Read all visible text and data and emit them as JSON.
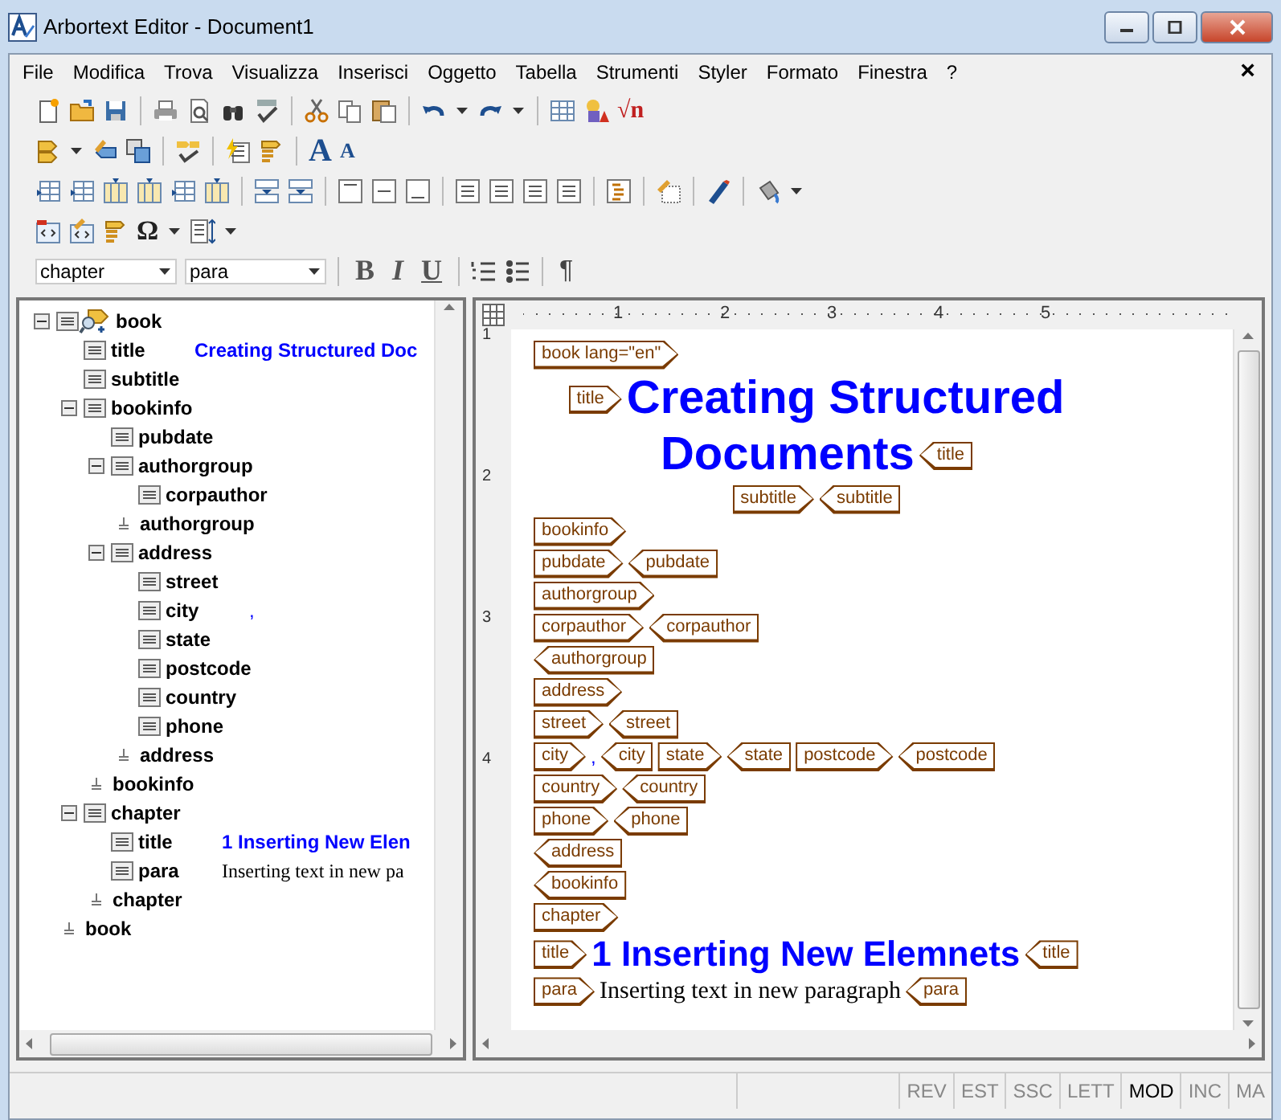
{
  "window": {
    "title": "Arbortext Editor - Document1"
  },
  "menu": {
    "items": [
      "File",
      "Modifica",
      "Trova",
      "Visualizza",
      "Inserisci",
      "Oggetto",
      "Tabella",
      "Strumenti",
      "Styler",
      "Formato",
      "Finestra",
      "?"
    ],
    "close": "×"
  },
  "toolbar_glyphs": [
    "√n",
    "A",
    "A",
    "Ω"
  ],
  "format_bar": {
    "element": "chapter",
    "style": "para",
    "buttons": [
      "B",
      "I",
      "U"
    ],
    "pilcrow": "¶"
  },
  "tree": [
    {
      "tag": "book",
      "kind": "open",
      "expanded": true,
      "children": [
        {
          "tag": "title",
          "kind": "leaf",
          "value": {
            "kind": "heading",
            "text": "Creating Structured Doc"
          }
        },
        {
          "tag": "subtitle",
          "kind": "leaf"
        },
        {
          "tag": "bookinfo",
          "kind": "open",
          "expanded": true,
          "children": [
            {
              "tag": "pubdate",
              "kind": "leaf"
            },
            {
              "tag": "authorgroup",
              "kind": "open",
              "expanded": true,
              "children": [
                {
                  "tag": "corpauthor",
                  "kind": "leaf"
                }
              ]
            },
            {
              "tag": "authorgroup",
              "kind": "close"
            },
            {
              "tag": "address",
              "kind": "open",
              "expanded": true,
              "children": [
                {
                  "tag": "street",
                  "kind": "leaf"
                },
                {
                  "tag": "city",
                  "kind": "leaf",
                  "value": {
                    "kind": "value",
                    "text": ","
                  }
                },
                {
                  "tag": "state",
                  "kind": "leaf"
                },
                {
                  "tag": "postcode",
                  "kind": "leaf"
                },
                {
                  "tag": "country",
                  "kind": "leaf"
                },
                {
                  "tag": "phone",
                  "kind": "leaf"
                }
              ]
            },
            {
              "tag": "address",
              "kind": "close"
            }
          ]
        },
        {
          "tag": "bookinfo",
          "kind": "close"
        },
        {
          "tag": "chapter",
          "kind": "open",
          "expanded": true,
          "children": [
            {
              "tag": "title",
              "kind": "leaf",
              "value": {
                "kind": "heading",
                "text": "1 Inserting New Elen"
              }
            },
            {
              "tag": "para",
              "kind": "leaf",
              "value": {
                "kind": "text",
                "text": "Inserting text in new pa"
              }
            }
          ]
        },
        {
          "tag": "chapter",
          "kind": "close"
        }
      ]
    },
    {
      "tag": "book",
      "kind": "close"
    }
  ],
  "ruler": {
    "marks": [
      "1",
      "2",
      "3",
      "4",
      "5"
    ]
  },
  "vertical_ruler": {
    "marks": [
      "1",
      "2",
      "3",
      "4"
    ]
  },
  "document": {
    "lines": [
      {
        "centered": false,
        "items": [
          {
            "kind": "open",
            "tag": "book lang=\"en\""
          }
        ]
      },
      {
        "centered": true,
        "items": [
          {
            "kind": "open",
            "tag": "title"
          },
          {
            "kind": "title",
            "text": "Creating Structured"
          }
        ]
      },
      {
        "centered": true,
        "items": [
          {
            "kind": "title",
            "text": "Documents"
          },
          {
            "kind": "close",
            "tag": "title"
          }
        ]
      },
      {
        "centered": true,
        "items": [
          {
            "kind": "open",
            "tag": "subtitle"
          },
          {
            "kind": "close",
            "tag": "subtitle"
          }
        ]
      },
      {
        "centered": false,
        "items": [
          {
            "kind": "open",
            "tag": "bookinfo"
          }
        ]
      },
      {
        "centered": false,
        "items": [
          {
            "kind": "open",
            "tag": "pubdate"
          },
          {
            "kind": "close",
            "tag": "pubdate"
          }
        ]
      },
      {
        "centered": false,
        "items": [
          {
            "kind": "open",
            "tag": "authorgroup"
          }
        ]
      },
      {
        "centered": false,
        "items": [
          {
            "kind": "open",
            "tag": "corpauthor"
          },
          {
            "kind": "close",
            "tag": "corpauthor"
          }
        ]
      },
      {
        "centered": false,
        "items": [
          {
            "kind": "close",
            "tag": "authorgroup"
          }
        ]
      },
      {
        "centered": false,
        "items": [
          {
            "kind": "open",
            "tag": "address"
          }
        ]
      },
      {
        "centered": false,
        "items": [
          {
            "kind": "open",
            "tag": "street"
          },
          {
            "kind": "close",
            "tag": "street"
          }
        ]
      },
      {
        "centered": false,
        "items": [
          {
            "kind": "open",
            "tag": "city"
          },
          {
            "kind": "value",
            "text": ","
          },
          {
            "kind": "close",
            "tag": "city"
          },
          {
            "kind": "open",
            "tag": "state"
          },
          {
            "kind": "close",
            "tag": "state"
          },
          {
            "kind": "open",
            "tag": "postcode"
          },
          {
            "kind": "close",
            "tag": "postcode"
          }
        ]
      },
      {
        "centered": false,
        "items": [
          {
            "kind": "open",
            "tag": "country"
          },
          {
            "kind": "close",
            "tag": "country"
          }
        ]
      },
      {
        "centered": false,
        "items": [
          {
            "kind": "open",
            "tag": "phone"
          },
          {
            "kind": "close",
            "tag": "phone"
          }
        ]
      },
      {
        "centered": false,
        "items": [
          {
            "kind": "close",
            "tag": "address"
          }
        ]
      },
      {
        "centered": false,
        "items": [
          {
            "kind": "close",
            "tag": "bookinfo"
          }
        ]
      },
      {
        "centered": false,
        "items": [
          {
            "kind": "open",
            "tag": "chapter"
          }
        ]
      },
      {
        "centered": false,
        "items": [
          {
            "kind": "open",
            "tag": "title"
          },
          {
            "kind": "section_title",
            "text": "1 Inserting New Elemnets"
          },
          {
            "kind": "close",
            "tag": "title"
          }
        ]
      },
      {
        "centered": false,
        "items": [
          {
            "kind": "open",
            "tag": "para"
          },
          {
            "kind": "text",
            "text": "Inserting text in new paragraph"
          },
          {
            "kind": "close",
            "tag": "para"
          }
        ]
      }
    ]
  },
  "status_bar": {
    "indicators": [
      {
        "text": "REV",
        "active": false
      },
      {
        "text": "EST",
        "active": false
      },
      {
        "text": "SSC",
        "active": false
      },
      {
        "text": "LETT",
        "active": false
      },
      {
        "text": "MOD",
        "active": true
      },
      {
        "text": "INC",
        "active": false
      },
      {
        "text": "MA",
        "active": false
      }
    ]
  }
}
